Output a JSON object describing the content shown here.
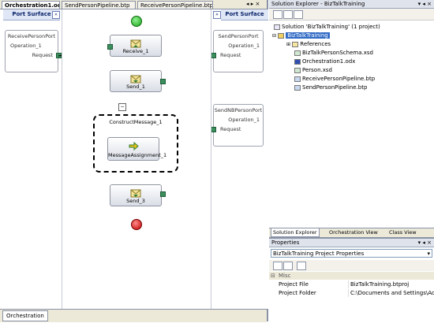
{
  "document": {
    "tabs": [
      {
        "label": "Orchestration1.odx",
        "active": true
      },
      {
        "label": "SendPersonPipeline.btp",
        "active": false
      },
      {
        "label": "ReceivePersonPipeline.btp",
        "active": false
      }
    ],
    "window_controls": "◂ ▸ ×",
    "port_surface_left": "Port Surface",
    "port_surface_right": "Port Surface",
    "bottom_tab": "Orchestration"
  },
  "ports": {
    "left": {
      "title": "ReceivePersonPort",
      "operation": "Operation_1",
      "role": "Request"
    },
    "right1": {
      "title": "SendPersonPort",
      "operation": "Operation_1",
      "role": "Request"
    },
    "right2": {
      "title": "SendNBPersonPort",
      "operation": "Operation_1",
      "role": "Request"
    }
  },
  "shapes": {
    "receive": "Receive_1",
    "send1": "Send_1",
    "construct": "ConstructMessage_1",
    "assign": "MessageAssignment_1",
    "send3": "Send_3"
  },
  "solution_explorer": {
    "title": "Solution Explorer - BizTalkTraining",
    "solution": "Solution 'BizTalkTraining' (1 project)",
    "project": "BizTalkTraining",
    "items": [
      "References",
      "BizTalkPersonSchema.xsd",
      "Orchestration1.odx",
      "Person.xsd",
      "ReceivePersonPipeline.btp",
      "SendPersonPipeline.btp"
    ],
    "bottom_tabs": [
      "Solution Explorer",
      "Orchestration View",
      "Class View"
    ]
  },
  "properties": {
    "title": "Properties",
    "selector": "BizTalkTraining Project Properties",
    "category": "Misc",
    "rows": [
      {
        "name": "Project File",
        "value": "BizTalkTraining.btproj"
      },
      {
        "name": "Project Folder",
        "value": "C:\\Documents and Settings\\Admin"
      }
    ]
  }
}
